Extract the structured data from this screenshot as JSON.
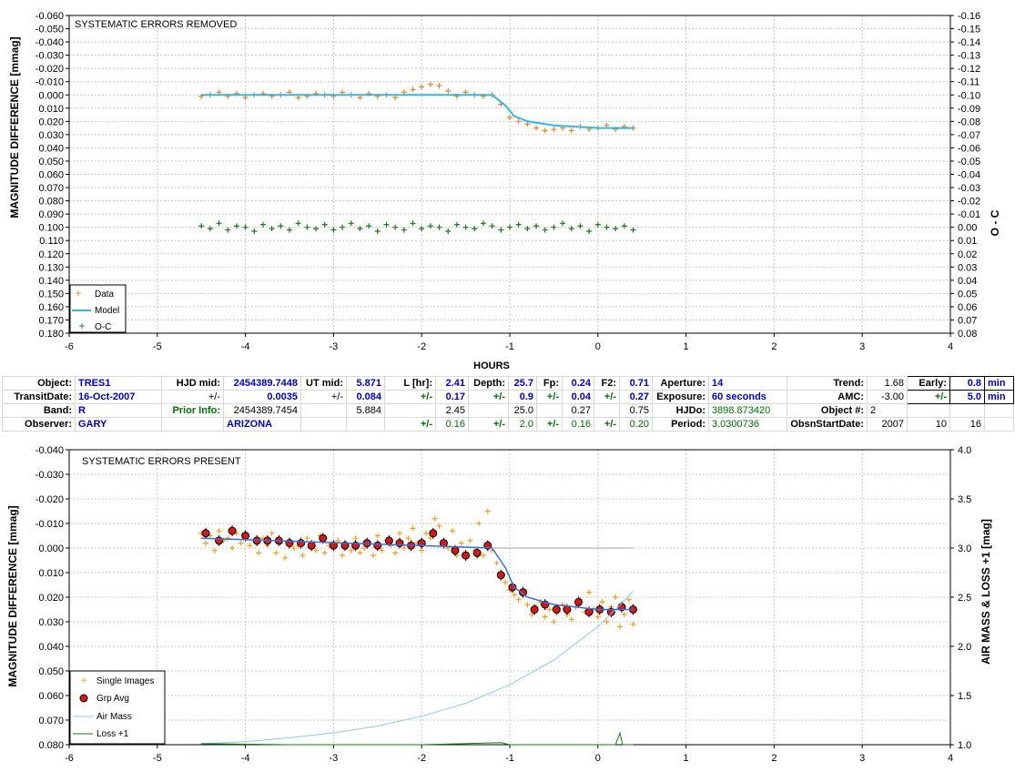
{
  "colors": {
    "data": "#f08020",
    "model": "#30b8e8",
    "oc": "#1a7a1a",
    "grp": "#d81818",
    "airmass": "#8ec8f0",
    "loss": "#1a7a1a",
    "blue_text": "#0000c8",
    "green_text": "#007000"
  },
  "top": {
    "title": "SYSTEMATIC ERRORS REMOVED",
    "ylabel": "MAGNITUDE DIFFERENCE [mmag]",
    "y2label": "O - C",
    "xlabel": "HOURS",
    "xticks": [
      "-6",
      "-5",
      "-4",
      "-3",
      "-2",
      "-1",
      "0",
      "1",
      "2",
      "3",
      "4"
    ],
    "yticks": [
      "-0.060",
      "-0.050",
      "-0.040",
      "-0.030",
      "-0.020",
      "-0.010",
      "0.000",
      "0.010",
      "0.020",
      "0.030",
      "0.040",
      "0.050",
      "0.060",
      "0.070",
      "0.080",
      "0.090",
      "0.100",
      "0.110",
      "0.120",
      "0.130",
      "0.140",
      "0.150",
      "0.160",
      "0.170",
      "0.180"
    ],
    "y2ticks": [
      "-0.16",
      "-0.15",
      "-0.14",
      "-0.13",
      "-0.12",
      "-0.11",
      "-0.10",
      "-0.09",
      "-0.08",
      "-0.07",
      "-0.06",
      "-0.05",
      "-0.04",
      "-0.03",
      "-0.02",
      "-0.01",
      "0.00",
      "0.01",
      "0.02",
      "0.03",
      "0.04",
      "0.05",
      "0.06",
      "0.07",
      "0.08"
    ],
    "legend": [
      "Data",
      "Model",
      "O-C"
    ]
  },
  "bottom": {
    "title": "SYSTEMATIC ERRORS PRESENT",
    "ylabel": "MAGNITUDE DIFFERENCE [mmag]",
    "y2label": "AIR MASS & LOSS +1 [mag]",
    "xticks": [
      "-6",
      "-5",
      "-4",
      "-3",
      "-2",
      "-1",
      "0",
      "1",
      "2",
      "3",
      "4"
    ],
    "yticks": [
      "-0.040",
      "-0.030",
      "-0.020",
      "-0.010",
      "0.000",
      "0.010",
      "0.020",
      "0.030",
      "0.040",
      "0.050",
      "0.060",
      "0.070",
      "0.080"
    ],
    "y2ticks": [
      "4.0",
      "3.5",
      "3.0",
      "2.5",
      "2.0",
      "1.5",
      "1.0"
    ],
    "legend": [
      "Single Images",
      "Grp Avg",
      "Air Mass",
      "Loss +1"
    ]
  },
  "params": {
    "rows": [
      [
        [
          "lbl",
          "Object:"
        ],
        [
          "val",
          "TRES1"
        ],
        [
          "lbl",
          "HJD mid:"
        ],
        [
          "val r",
          "2454389.7448"
        ],
        [
          "lbl",
          "UT mid:"
        ],
        [
          "val r",
          "5.871"
        ],
        [
          "lbl",
          "L [hr]:"
        ],
        [
          "val r",
          "2.41"
        ],
        [
          "lbl",
          "Depth:"
        ],
        [
          "val r",
          "25.7"
        ],
        [
          "lbl",
          "Fp:"
        ],
        [
          "val r",
          "0.24"
        ],
        [
          "lbl",
          "F2:"
        ],
        [
          "val r",
          "0.71"
        ],
        [
          "lbl",
          "Aperture:"
        ],
        [
          "val",
          "14"
        ],
        [
          "lbl",
          "Trend:"
        ],
        [
          "r",
          "1.68"
        ],
        [
          "lbl box",
          "Early:"
        ],
        [
          "val r box",
          "0.8"
        ],
        [
          "val box",
          "min"
        ]
      ],
      [
        [
          "lbl",
          "TransitDate:"
        ],
        [
          "val",
          "16-Oct-2007"
        ],
        [
          "r",
          "+/-"
        ],
        [
          "val r",
          "0.0035"
        ],
        [
          "r",
          "+/-"
        ],
        [
          "val r",
          "0.084"
        ],
        [
          "gb",
          "+/-"
        ],
        [
          "val r",
          "0.17"
        ],
        [
          "gb",
          "+/-"
        ],
        [
          "val r",
          "0.9"
        ],
        [
          "gb",
          "+/-"
        ],
        [
          "val r",
          "0.04"
        ],
        [
          "gb",
          "+/-"
        ],
        [
          "val r",
          "0.27"
        ],
        [
          "lbl",
          "Exposure:"
        ],
        [
          "val",
          "60 seconds"
        ],
        [
          "lbl",
          "AMC:"
        ],
        [
          "r",
          "-3.00"
        ],
        [
          "gb box",
          "+/-"
        ],
        [
          "val r box",
          "5.0"
        ],
        [
          "val box",
          "min"
        ]
      ],
      [
        [
          "lbl",
          "Band:"
        ],
        [
          "val",
          "R"
        ],
        [
          "gb",
          "Prior Info:"
        ],
        [
          "r",
          "2454389.7454"
        ],
        [
          "",
          ""
        ],
        [
          "r",
          "5.884"
        ],
        [
          "",
          ""
        ],
        [
          "r",
          "2.45"
        ],
        [
          "",
          ""
        ],
        [
          "r",
          "25.0"
        ],
        [
          "",
          ""
        ],
        [
          "r",
          "0.27"
        ],
        [
          "",
          ""
        ],
        [
          "r",
          "0.75"
        ],
        [
          "lbl",
          "HJDo:"
        ],
        [
          "g",
          "3898.873420"
        ],
        [
          "lbl",
          "Object #:"
        ],
        [
          "",
          "2"
        ],
        [
          "",
          ""
        ],
        [
          "",
          ""
        ],
        [
          "",
          ""
        ]
      ],
      [
        [
          "lbl",
          "Observer:"
        ],
        [
          "val",
          "GARY"
        ],
        [
          "",
          ""
        ],
        [
          "val",
          "ARIZONA"
        ],
        [
          "",
          ""
        ],
        [
          "",
          ""
        ],
        [
          "gb",
          "+/-"
        ],
        [
          "g r",
          "0.16"
        ],
        [
          "gb",
          "+/-"
        ],
        [
          "g r",
          "2.0"
        ],
        [
          "gb",
          "+/-"
        ],
        [
          "g r",
          "0.16"
        ],
        [
          "gb",
          "+/-"
        ],
        [
          "g r",
          "0.20"
        ],
        [
          "lbl",
          "Period:"
        ],
        [
          "g",
          "3.0300736"
        ],
        [
          "lbl",
          "ObsnStartDate:"
        ],
        [
          "r",
          "2007"
        ],
        [
          "r",
          "10"
        ],
        [
          "r",
          "16"
        ],
        [
          "",
          ""
        ]
      ]
    ]
  },
  "chart_data": [
    {
      "type": "scatter",
      "title": "SYSTEMATIC ERRORS REMOVED",
      "xlabel": "HOURS",
      "ylabel": "MAGNITUDE DIFFERENCE [mmag]",
      "y2label": "O - C",
      "xlim": [
        -6,
        4
      ],
      "ylim": [
        -0.06,
        0.18
      ],
      "y2lim": [
        -0.16,
        0.08
      ],
      "y_inverted": true,
      "grid": true,
      "legend_position": "bottom-left",
      "series": [
        {
          "name": "Data",
          "kind": "scatter",
          "marker": "+",
          "x": [
            -4.5,
            -4.4,
            -4.3,
            -4.2,
            -4.1,
            -4.0,
            -3.9,
            -3.8,
            -3.7,
            -3.6,
            -3.5,
            -3.4,
            -3.3,
            -3.2,
            -3.1,
            -3.0,
            -2.9,
            -2.8,
            -2.7,
            -2.6,
            -2.5,
            -2.4,
            -2.3,
            -2.2,
            -2.1,
            -2.0,
            -1.9,
            -1.8,
            -1.7,
            -1.6,
            -1.5,
            -1.4,
            -1.3,
            -1.2,
            -1.1,
            -1.0,
            -0.9,
            -0.8,
            -0.7,
            -0.6,
            -0.5,
            -0.4,
            -0.3,
            -0.2,
            -0.1,
            0.0,
            0.1,
            0.2,
            0.3,
            0.4
          ],
          "y": [
            0.001,
            0.0,
            -0.002,
            0.001,
            -0.001,
            0.002,
            0.0,
            -0.001,
            0.001,
            0.0,
            -0.002,
            0.002,
            0.001,
            -0.001,
            0.0,
            0.001,
            -0.002,
            0.0,
            0.002,
            -0.001,
            0.001,
            0.0,
            0.002,
            -0.002,
            -0.004,
            -0.006,
            -0.008,
            -0.007,
            -0.003,
            0.001,
            -0.002,
            0.0,
            0.001,
            0.0,
            0.007,
            0.017,
            0.02,
            0.022,
            0.025,
            0.027,
            0.026,
            0.025,
            0.027,
            0.024,
            0.026,
            0.025,
            0.023,
            0.026,
            0.024,
            0.025
          ]
        },
        {
          "name": "Model",
          "kind": "line",
          "x": [
            -4.5,
            -1.2,
            -1.05,
            -0.95,
            -0.8,
            -0.5,
            0.0,
            0.4
          ],
          "y": [
            0.0,
            0.0,
            0.008,
            0.016,
            0.02,
            0.023,
            0.025,
            0.025
          ]
        },
        {
          "name": "O-C",
          "kind": "scatter",
          "marker": "+",
          "x": [
            -4.5,
            -4.4,
            -4.3,
            -4.2,
            -4.1,
            -4.0,
            -3.9,
            -3.8,
            -3.7,
            -3.6,
            -3.5,
            -3.4,
            -3.3,
            -3.2,
            -3.1,
            -3.0,
            -2.9,
            -2.8,
            -2.7,
            -2.6,
            -2.5,
            -2.4,
            -2.3,
            -2.2,
            -2.1,
            -2.0,
            -1.9,
            -1.8,
            -1.7,
            -1.6,
            -1.5,
            -1.4,
            -1.3,
            -1.2,
            -1.1,
            -1.0,
            -0.9,
            -0.8,
            -0.7,
            -0.6,
            -0.5,
            -0.4,
            -0.3,
            -0.2,
            -0.1,
            0.0,
            0.1,
            0.2,
            0.3,
            0.4
          ],
          "y": [
            0.099,
            0.101,
            0.097,
            0.102,
            0.099,
            0.1,
            0.103,
            0.098,
            0.101,
            0.099,
            0.102,
            0.097,
            0.1,
            0.101,
            0.098,
            0.102,
            0.1,
            0.097,
            0.101,
            0.099,
            0.103,
            0.098,
            0.1,
            0.102,
            0.097,
            0.101,
            0.099,
            0.1,
            0.103,
            0.098,
            0.1,
            0.101,
            0.097,
            0.099,
            0.102,
            0.1,
            0.098,
            0.101,
            0.099,
            0.102,
            0.1,
            0.097,
            0.101,
            0.099,
            0.103,
            0.098,
            0.1,
            0.101,
            0.099,
            0.102
          ]
        }
      ]
    },
    {
      "type": "scatter",
      "title": "SYSTEMATIC ERRORS PRESENT",
      "ylabel": "MAGNITUDE DIFFERENCE [mmag]",
      "y2label": "AIR MASS & LOSS +1 [mag]",
      "xlim": [
        -6,
        4
      ],
      "ylim": [
        -0.04,
        0.08
      ],
      "y2lim": [
        1.0,
        4.0
      ],
      "y_inverted": true,
      "grid": true,
      "legend_position": "bottom-left",
      "series": [
        {
          "name": "Single Images",
          "kind": "scatter",
          "marker": "+",
          "x": [
            -4.5,
            -4.45,
            -4.4,
            -4.35,
            -4.3,
            -4.25,
            -4.2,
            -4.15,
            -4.1,
            -4.05,
            -4.0,
            -3.95,
            -3.9,
            -3.85,
            -3.8,
            -3.75,
            -3.7,
            -3.65,
            -3.6,
            -3.55,
            -3.5,
            -3.45,
            -3.4,
            -3.35,
            -3.3,
            -3.25,
            -3.2,
            -3.15,
            -3.1,
            -3.05,
            -3.0,
            -2.95,
            -2.9,
            -2.85,
            -2.8,
            -2.75,
            -2.7,
            -2.65,
            -2.6,
            -2.55,
            -2.5,
            -2.45,
            -2.4,
            -2.35,
            -2.3,
            -2.25,
            -2.2,
            -2.15,
            -2.1,
            -2.05,
            -2.0,
            -1.95,
            -1.9,
            -1.85,
            -1.8,
            -1.75,
            -1.7,
            -1.65,
            -1.6,
            -1.55,
            -1.5,
            -1.45,
            -1.4,
            -1.35,
            -1.3,
            -1.25,
            -1.2,
            -1.15,
            -1.1,
            -1.05,
            -1.0,
            -0.95,
            -0.9,
            -0.85,
            -0.8,
            -0.75,
            -0.7,
            -0.65,
            -0.6,
            -0.55,
            -0.5,
            -0.45,
            -0.4,
            -0.35,
            -0.3,
            -0.25,
            -0.2,
            -0.15,
            -0.1,
            -0.05,
            0.0,
            0.05,
            0.1,
            0.15,
            0.2,
            0.25,
            0.3,
            0.35,
            0.4
          ],
          "y": [
            -0.006,
            -0.002,
            -0.005,
            0.001,
            -0.007,
            -0.003,
            -0.004,
            0.0,
            -0.006,
            -0.002,
            -0.005,
            -0.001,
            -0.003,
            0.002,
            -0.004,
            -0.001,
            -0.006,
            0.002,
            -0.002,
            0.004,
            -0.003,
            0.0,
            -0.001,
            0.003,
            -0.004,
            -0.002,
            0.001,
            -0.005,
            0.002,
            -0.001,
            0.0,
            -0.003,
            0.003,
            -0.001,
            0.001,
            -0.004,
            0.002,
            0.0,
            -0.002,
            0.003,
            -0.005,
            0.001,
            -0.003,
            -0.001,
            0.002,
            -0.006,
            0.0,
            -0.004,
            -0.008,
            -0.002,
            0.001,
            -0.006,
            -0.004,
            -0.012,
            -0.009,
            -0.003,
            0.0,
            -0.007,
            0.003,
            -0.002,
            0.004,
            -0.003,
            0.001,
            -0.01,
            0.003,
            -0.015,
            0.001,
            0.006,
            0.01,
            0.014,
            0.017,
            0.019,
            0.021,
            0.018,
            0.023,
            0.027,
            0.024,
            0.022,
            0.028,
            0.025,
            0.03,
            0.026,
            0.023,
            0.027,
            0.029,
            0.024,
            0.021,
            0.026,
            0.018,
            0.025,
            0.028,
            0.022,
            0.03,
            0.024,
            0.02,
            0.032,
            0.027,
            0.021,
            0.031
          ],
          "yerr": []
        },
        {
          "name": "Grp Avg",
          "kind": "scatter",
          "marker": "o",
          "x": [
            -4.45,
            -4.3,
            -4.15,
            -4.0,
            -3.87,
            -3.75,
            -3.62,
            -3.5,
            -3.37,
            -3.25,
            -3.12,
            -3.0,
            -2.87,
            -2.75,
            -2.62,
            -2.5,
            -2.37,
            -2.25,
            -2.12,
            -2.0,
            -1.87,
            -1.75,
            -1.62,
            -1.5,
            -1.37,
            -1.25,
            -1.1,
            -0.97,
            -0.85,
            -0.72,
            -0.6,
            -0.47,
            -0.35,
            -0.22,
            -0.1,
            0.02,
            0.15,
            0.27,
            0.4
          ],
          "y": [
            -0.006,
            -0.003,
            -0.007,
            -0.005,
            -0.003,
            -0.003,
            -0.003,
            -0.002,
            -0.002,
            -0.001,
            -0.004,
            -0.001,
            -0.001,
            -0.001,
            -0.002,
            -0.001,
            -0.003,
            -0.002,
            -0.001,
            -0.002,
            -0.006,
            -0.002,
            0.001,
            0.003,
            0.002,
            -0.001,
            0.011,
            0.016,
            0.018,
            0.025,
            0.023,
            0.025,
            0.025,
            0.022,
            0.026,
            0.025,
            0.026,
            0.024,
            0.025
          ]
        },
        {
          "name": "Air Mass",
          "kind": "line",
          "axis": "y2",
          "x": [
            -4.5,
            -4.0,
            -3.5,
            -3.0,
            -2.5,
            -2.0,
            -1.5,
            -1.0,
            -0.5,
            0.0,
            0.25,
            0.4
          ],
          "y": [
            1.01,
            1.03,
            1.07,
            1.12,
            1.19,
            1.29,
            1.42,
            1.61,
            1.86,
            2.2,
            2.42,
            2.56
          ]
        },
        {
          "name": "Loss +1",
          "kind": "line",
          "axis": "y2",
          "x": [
            -4.5,
            -3.5,
            -2.0,
            -1.1,
            -1.0,
            0.2,
            0.25,
            0.28,
            0.4
          ],
          "y": [
            1.01,
            1.0,
            1.0,
            1.02,
            1.0,
            1.0,
            1.12,
            1.0,
            1.0
          ]
        },
        {
          "name": "Model",
          "kind": "line",
          "x": [
            -4.5,
            -1.2,
            -1.05,
            -0.95,
            -0.8,
            -0.5,
            0.0,
            0.4
          ],
          "y": [
            -0.004,
            0.0,
            0.008,
            0.016,
            0.02,
            0.023,
            0.025,
            0.025
          ]
        },
        {
          "name": "Baseline",
          "kind": "line",
          "x": [
            -1.2,
            0.0,
            0.4
          ],
          "y": [
            0.0,
            0.0,
            0.0
          ]
        }
      ]
    }
  ]
}
